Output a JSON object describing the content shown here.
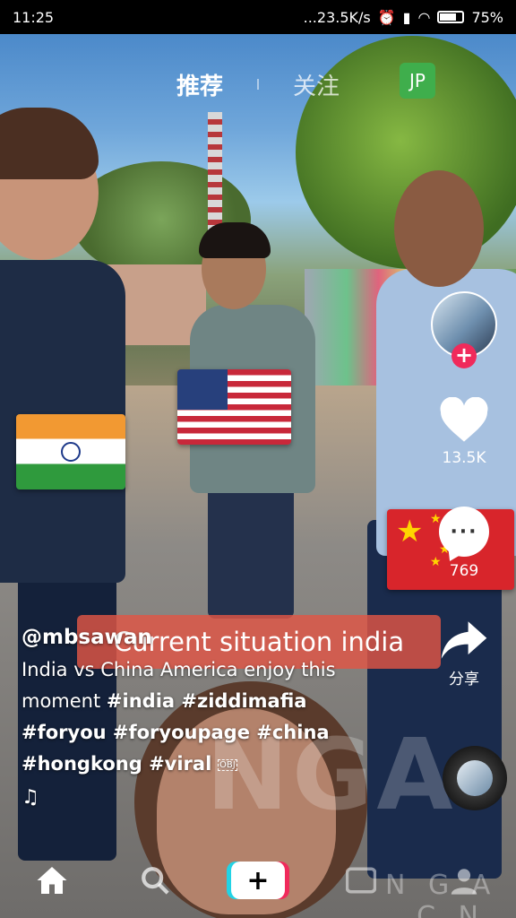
{
  "status_bar": {
    "time": "11:25",
    "net_speed": "...23.5K/s",
    "battery": "75%"
  },
  "top_tabs": [
    {
      "label": "推荐",
      "active": true
    },
    {
      "label": "关注",
      "active": false
    }
  ],
  "live_badge": "JP",
  "post": {
    "username": "@mbsawan",
    "description": "India vs China America enjoy this moment",
    "hashtags": "#india #ziddimafia #foryou #foryoupage #china #hongkong #viral",
    "obj_marker": "OBJ",
    "overlay_text": "Current situation india",
    "likes": "13.5K",
    "comments": "769",
    "share_label": "分享"
  },
  "watermark": {
    "logo": "NGA",
    "domain": "N G A . C N"
  },
  "icons": {
    "home": "home-icon",
    "search": "search-icon",
    "create": "plus-icon",
    "inbox": "inbox-icon",
    "profile": "profile-icon",
    "like": "heart-icon",
    "comment": "comment-icon",
    "share": "share-icon",
    "music": "music-note-icon"
  },
  "colors": {
    "like_red": "#f02a5b",
    "tiktok_cyan": "#22d3e5",
    "overlay_bg": "#e15546"
  }
}
